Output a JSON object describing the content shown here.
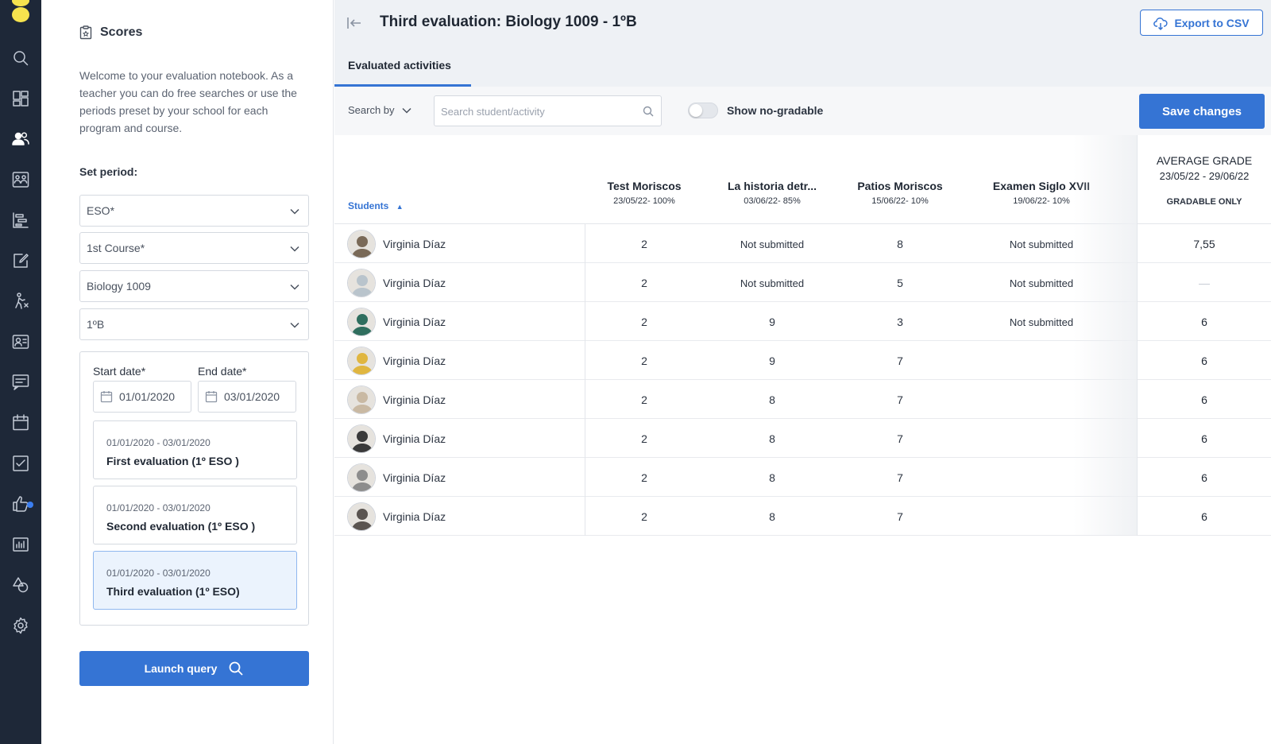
{
  "rail": {
    "icons": [
      "search-icon",
      "dashboard-icon",
      "users-icon",
      "groups-icon",
      "timeline-icon",
      "edit-icon",
      "activity-icon",
      "contacts-icon",
      "messages-icon",
      "calendar-icon",
      "tasks-icon",
      "likes-icon",
      "stats-icon",
      "shapes-icon",
      "settings-icon"
    ],
    "active": "users-icon"
  },
  "panel": {
    "title": "Scores",
    "intro": "Welcome to your evaluation notebook. As a teacher you can do free searches or use the periods preset by your school for each program and course.",
    "set_period": "Set period:",
    "selects": [
      "ESO*",
      "1st Course*",
      "Biology 1009",
      "1ºB"
    ],
    "start_label": "Start date*",
    "end_label": "End date*",
    "start_value": "01/01/2020",
    "end_value": "03/01/2020",
    "periods": [
      {
        "range": "01/01/2020 - 03/01/2020",
        "name": "First evaluation (1º ESO )"
      },
      {
        "range": "01/01/2020 - 03/01/2020",
        "name": "Second evaluation (1º ESO )"
      },
      {
        "range": "01/01/2020 - 03/01/2020",
        "name": "Third evaluation (1º ESO)"
      }
    ],
    "selected_period": 2,
    "launch": "Launch query"
  },
  "header": {
    "title": "Third evaluation: Biology 1009 - 1ºB",
    "export": "Export to CSV",
    "tab": "Evaluated activities"
  },
  "toolbar": {
    "search_by": "Search by",
    "search_placeholder": "Search student/activity",
    "toggle_label": "Show no-gradable",
    "toggle_on": false,
    "save": "Save changes"
  },
  "table": {
    "students_header": "Students",
    "activities": [
      {
        "title": "Test Moriscos",
        "sub": "23/05/22- 100%"
      },
      {
        "title": "La historia detr...",
        "sub": "03/06/22- 85%"
      },
      {
        "title": "Patios Moriscos",
        "sub": "15/06/22- 10%"
      },
      {
        "title": "Examen Siglo XVII",
        "sub": "19/06/22- 10%"
      }
    ],
    "average": {
      "title": "AVERAGE GRADE",
      "dates": "23/05/22 - 29/06/22",
      "note": "GRADABLE ONLY"
    },
    "rows": [
      {
        "name": "Virginia Díaz",
        "cells": [
          "2",
          "Not submitted",
          "8",
          "Not submitted"
        ],
        "avg": "7,55"
      },
      {
        "name": "Virginia Díaz",
        "cells": [
          "2",
          "Not submitted",
          "5",
          "Not submitted"
        ],
        "avg": "—"
      },
      {
        "name": "Virginia Díaz",
        "cells": [
          "2",
          "9",
          "3",
          "Not submitted"
        ],
        "avg": "6"
      },
      {
        "name": "Virginia Díaz",
        "cells": [
          "2",
          "9",
          "7",
          ""
        ],
        "avg": "6"
      },
      {
        "name": "Virginia Díaz",
        "cells": [
          "2",
          "8",
          "7",
          ""
        ],
        "avg": "6"
      },
      {
        "name": "Virginia Díaz",
        "cells": [
          "2",
          "8",
          "7",
          ""
        ],
        "avg": "6"
      },
      {
        "name": "Virginia Díaz",
        "cells": [
          "2",
          "8",
          "7",
          ""
        ],
        "avg": "6"
      },
      {
        "name": "Virginia Díaz",
        "cells": [
          "2",
          "8",
          "7",
          ""
        ],
        "avg": "6"
      }
    ],
    "avatar_colors": [
      "#7a6a58",
      "#b9c4cc",
      "#2f6e5e",
      "#e0b640",
      "#c9b9a3",
      "#3a3a3a",
      "#8d8d8d",
      "#5a5450"
    ]
  }
}
